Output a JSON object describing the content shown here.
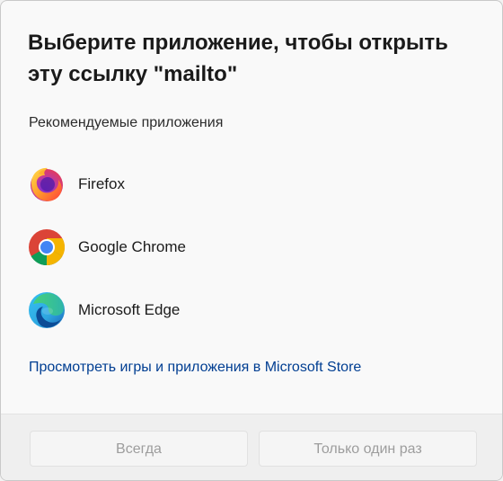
{
  "dialog": {
    "title": "Выберите приложение, чтобы открыть эту ссылку \"mailto\"",
    "section_label": "Рекомендуемые приложения",
    "apps": [
      {
        "name": "Firefox",
        "icon": "firefox-icon"
      },
      {
        "name": "Google Chrome",
        "icon": "chrome-icon"
      },
      {
        "name": "Microsoft Edge",
        "icon": "edge-icon"
      }
    ],
    "store_link": "Просмотреть игры и приложения в Microsoft Store",
    "buttons": {
      "always": "Всегда",
      "once": "Только один раз"
    },
    "colors": {
      "link": "#003e92",
      "disabled_text": "#9d9d9d",
      "background": "#f9f9f9"
    }
  }
}
